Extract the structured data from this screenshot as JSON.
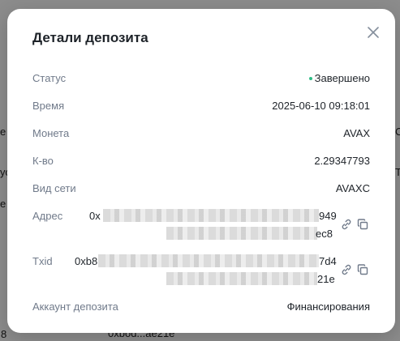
{
  "modal": {
    "title": "Детали депозита",
    "rows": {
      "status": {
        "label": "Статус",
        "value": "Завершено"
      },
      "time": {
        "label": "Время",
        "value": "2025-06-10 09:18:01"
      },
      "coin": {
        "label": "Монета",
        "value": "AVAX"
      },
      "amount": {
        "label": "К-во",
        "value": "2.29347793"
      },
      "network": {
        "label": "Вид сети",
        "value": "AVAXC"
      },
      "address": {
        "label": "Адрес",
        "start": "0x",
        "end1": "949",
        "end2": "ec8"
      },
      "txid": {
        "label": "Txid",
        "start": "0xb8",
        "end1": "7d4",
        "end2": "21e"
      },
      "account": {
        "label": "Аккаунт депозита",
        "value": "Финансирования"
      }
    },
    "icons": {
      "close": "close-icon",
      "link": "link-icon",
      "copy": "copy-icon"
    },
    "colors": {
      "status_dot": "#2ebd85",
      "title": "#1e2329",
      "label": "#707a8a"
    }
  },
  "background": {
    "fragments": {
      "a": "е",
      "b": "ус",
      "c": "e",
      "d": "Ст",
      "e": "Т",
      "f": "8",
      "g": "0xbod...ae21e"
    }
  }
}
